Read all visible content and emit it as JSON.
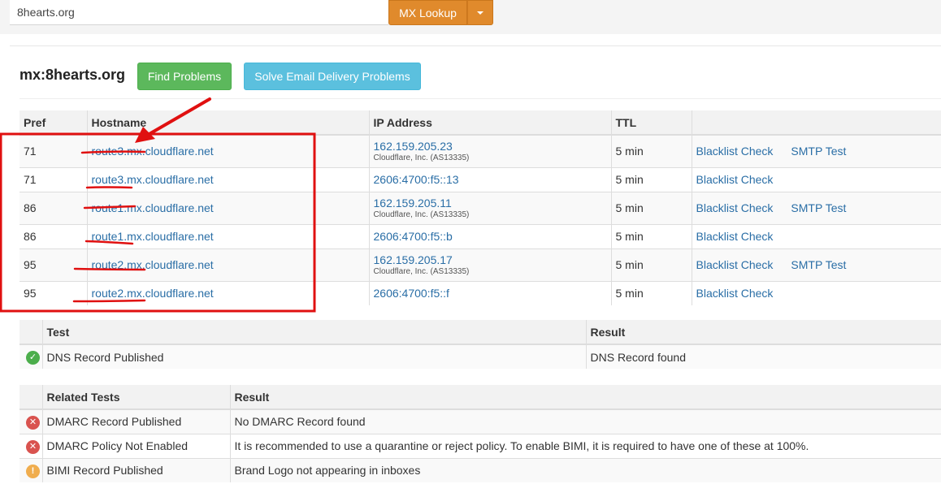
{
  "search": {
    "value": "8hearts.org"
  },
  "toolbar": {
    "lookup_label": "MX Lookup"
  },
  "header": {
    "title": "mx:8hearts.org",
    "find_problems_label": "Find Problems",
    "solve_label": "Solve Email Delivery Problems"
  },
  "mx_table": {
    "headers": [
      "Pref",
      "Hostname",
      "IP Address",
      "TTL",
      ""
    ],
    "rows": [
      {
        "pref": "71",
        "hostname": "route3.mx.cloudflare.net",
        "ip": "162.159.205.23",
        "org": "Cloudflare, Inc. (AS13335)",
        "ttl": "5 min",
        "blacklist": "Blacklist Check",
        "smtp": "SMTP Test"
      },
      {
        "pref": "71",
        "hostname": "route3.mx.cloudflare.net",
        "ip": "2606:4700:f5::13",
        "org": "",
        "ttl": "5 min",
        "blacklist": "Blacklist Check",
        "smtp": ""
      },
      {
        "pref": "86",
        "hostname": "route1.mx.cloudflare.net",
        "ip": "162.159.205.11",
        "org": "Cloudflare, Inc. (AS13335)",
        "ttl": "5 min",
        "blacklist": "Blacklist Check",
        "smtp": "SMTP Test"
      },
      {
        "pref": "86",
        "hostname": "route1.mx.cloudflare.net",
        "ip": "2606:4700:f5::b",
        "org": "",
        "ttl": "5 min",
        "blacklist": "Blacklist Check",
        "smtp": ""
      },
      {
        "pref": "95",
        "hostname": "route2.mx.cloudflare.net",
        "ip": "162.159.205.17",
        "org": "Cloudflare, Inc. (AS13335)",
        "ttl": "5 min",
        "blacklist": "Blacklist Check",
        "smtp": "SMTP Test"
      },
      {
        "pref": "95",
        "hostname": "route2.mx.cloudflare.net",
        "ip": "2606:4700:f5::f",
        "org": "",
        "ttl": "5 min",
        "blacklist": "Blacklist Check",
        "smtp": ""
      }
    ]
  },
  "test_table": {
    "headers": [
      "",
      "Test",
      "Result"
    ],
    "rows": [
      {
        "status": "ok",
        "icon": "check-icon",
        "test": "DNS Record Published",
        "result": "DNS Record found"
      }
    ]
  },
  "related_table": {
    "headers": [
      "",
      "Related Tests",
      "Result"
    ],
    "rows": [
      {
        "status": "err",
        "icon": "x-icon",
        "test": "DMARC Record Published",
        "result": "No DMARC Record found"
      },
      {
        "status": "err",
        "icon": "x-icon",
        "test": "DMARC Policy Not Enabled",
        "result": "It is recommended to use a quarantine or reject policy. To enable BIMI, it is required to have one of these at 100%."
      },
      {
        "status": "warn",
        "icon": "exclamation-icon",
        "test": "BIMI Record Published",
        "result": "Brand Logo not appearing in inboxes"
      }
    ]
  },
  "colors": {
    "link": "#2a6ea6",
    "annotation_red": "#e01010",
    "mx_button": "#e08a2c",
    "green_button": "#5cb85c",
    "blue_button": "#5bc0de"
  }
}
